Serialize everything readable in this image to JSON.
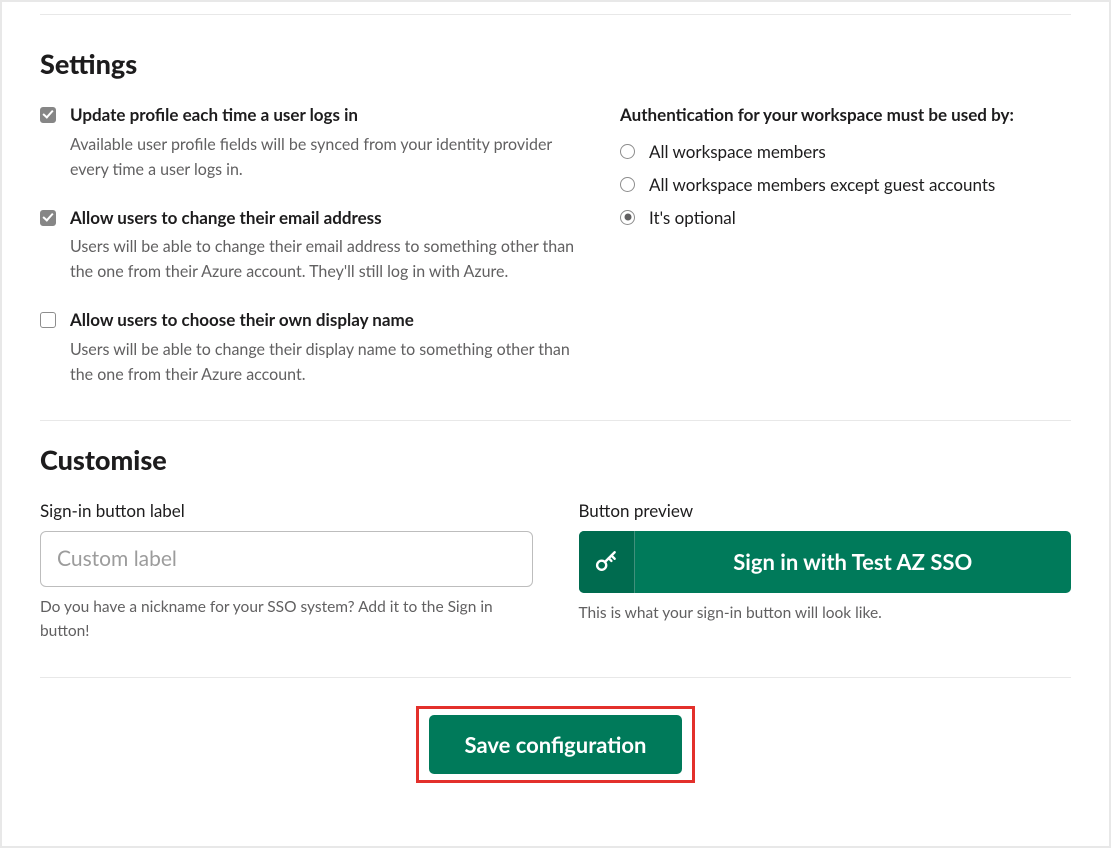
{
  "settings": {
    "title": "Settings",
    "options": [
      {
        "title": "Update profile each time a user logs in",
        "desc": "Available user profile fields will be synced from your identity provider every time a user logs in.",
        "checked": true
      },
      {
        "title": "Allow users to change their email address",
        "desc": "Users will be able to change their email address to something other than the one from their Azure account. They'll still log in with Azure.",
        "checked": true
      },
      {
        "title": "Allow users to choose their own display name",
        "desc": "Users will be able to change their display name to something other than the one from their Azure account.",
        "checked": false
      }
    ],
    "auth": {
      "title": "Authentication for your workspace must be used by:",
      "options": [
        "All workspace members",
        "All workspace members except guest accounts",
        "It's optional"
      ],
      "selected_index": 2
    }
  },
  "customise": {
    "title": "Customise",
    "signin_label_title": "Sign-in button label",
    "signin_placeholder": "Custom label",
    "signin_value": "",
    "helper": "Do you have a nickname for your SSO system? Add it to the Sign in button!",
    "preview_title": "Button preview",
    "preview_button": "Sign in with Test AZ SSO",
    "preview_helper": "This is what your sign-in button will look like."
  },
  "footer": {
    "save": "Save configuration"
  }
}
